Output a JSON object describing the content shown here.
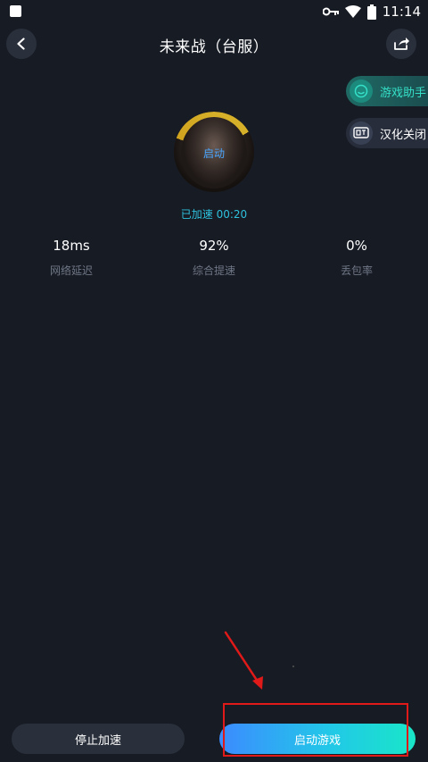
{
  "status_bar": {
    "time": "11:14"
  },
  "header": {
    "title": "未来战（台服）"
  },
  "side_buttons": {
    "assistant": "游戏助手",
    "translate": "汉化关闭"
  },
  "avatar": {
    "label": "启动"
  },
  "accel_time": "已加速 00:20",
  "stats": [
    {
      "value": "18ms",
      "label": "网络延迟"
    },
    {
      "value": "92%",
      "label": "综合提速"
    },
    {
      "value": "0%",
      "label": "丢包率"
    }
  ],
  "bottom": {
    "stop_label": "停止加速",
    "launch_label": "启动游戏"
  },
  "colors": {
    "accent_teal": "#35e0c8",
    "accent_blue": "#2ec1dd",
    "annotation_red": "#e01919"
  }
}
